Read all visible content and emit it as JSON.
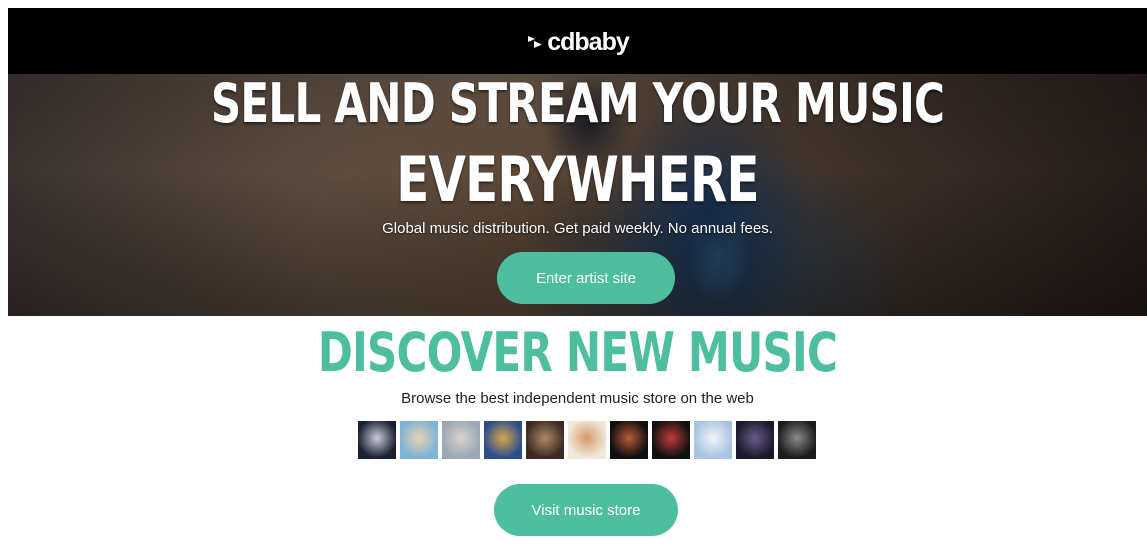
{
  "header": {
    "logo_text": "cdbaby",
    "logo_icon": "cdbaby-arrow-logo"
  },
  "hero": {
    "title_line1": "SELL AND STREAM YOUR MUSIC",
    "title_line2": "EVERYWHERE",
    "subtitle": "Global music distribution. Get paid weekly. No annual fees.",
    "cta_label": "Enter artist site"
  },
  "discover": {
    "title": "DISCOVER NEW MUSIC",
    "subtitle": "Browse the best independent music store on the web",
    "albums": [
      {
        "colors": [
          "#1b1f2e",
          "#c9ccd8"
        ]
      },
      {
        "colors": [
          "#7fb2d8",
          "#e6d3b0"
        ]
      },
      {
        "colors": [
          "#9aa7b5",
          "#d8d3c8"
        ]
      },
      {
        "colors": [
          "#2b4d8c",
          "#d8a64a"
        ]
      },
      {
        "colors": [
          "#3a2a22",
          "#b08a66"
        ]
      },
      {
        "colors": [
          "#efe9d9",
          "#d89a6a"
        ]
      },
      {
        "colors": [
          "#0e0e0e",
          "#b85a3a"
        ]
      },
      {
        "colors": [
          "#101010",
          "#c23a3a"
        ]
      },
      {
        "colors": [
          "#a8c4e0",
          "#f0f4f8"
        ]
      },
      {
        "colors": [
          "#1a1a2a",
          "#6a5a8a"
        ]
      },
      {
        "colors": [
          "#1c1c1c",
          "#8a8a8a"
        ]
      }
    ],
    "cta_label": "Visit music store"
  },
  "colors": {
    "accent": "#4dbf9f",
    "header_bg": "#000000"
  }
}
